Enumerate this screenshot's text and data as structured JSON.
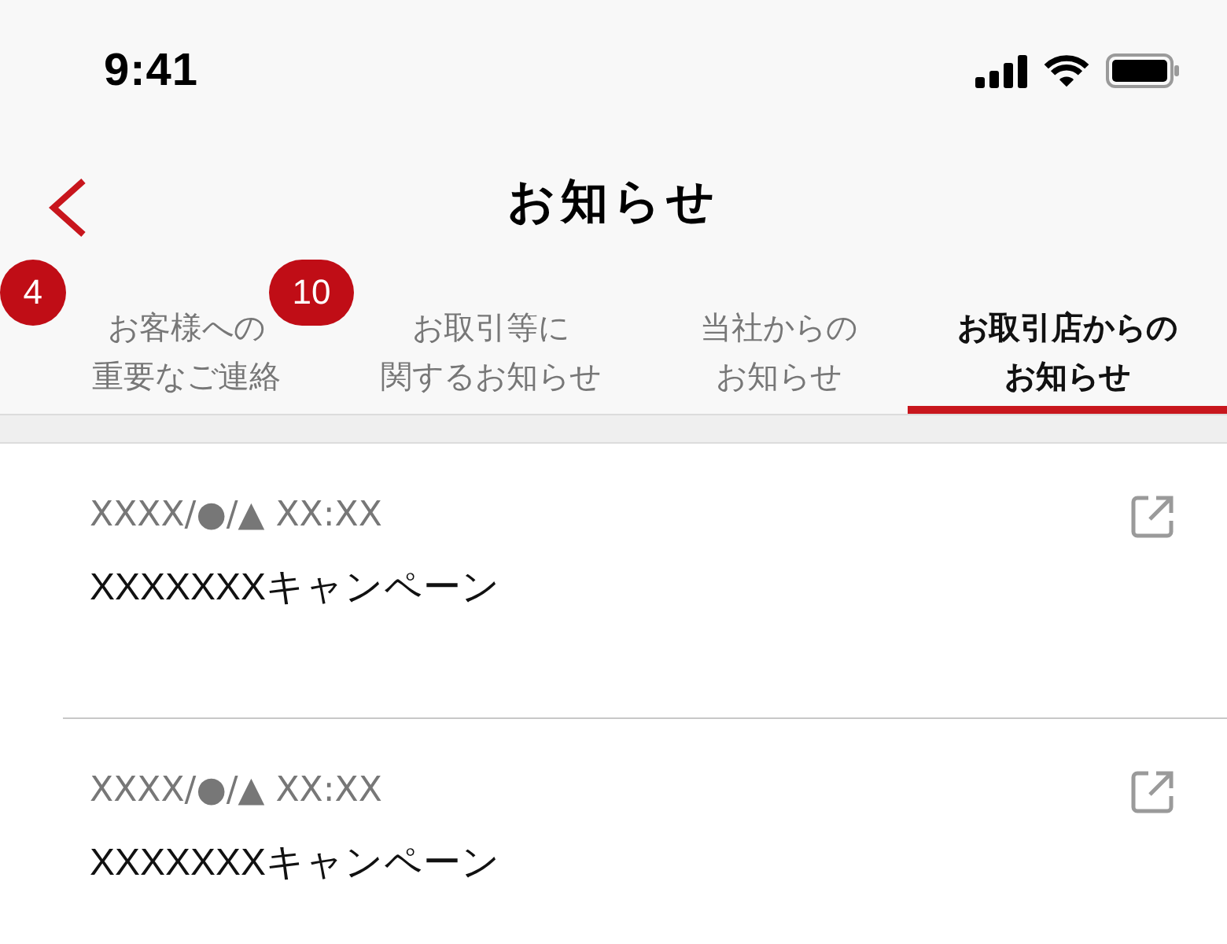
{
  "status_bar": {
    "time": "9:41"
  },
  "nav_bar": {
    "title": "お知らせ"
  },
  "tabs": [
    {
      "label_lines": [
        "お客様への",
        "重要なご連絡"
      ],
      "badge": "4",
      "selected": false
    },
    {
      "label_lines": [
        "お取引等に",
        "関するお知らせ"
      ],
      "badge": "10",
      "selected": false
    },
    {
      "label_lines": [
        "当社からの",
        "お知らせ"
      ],
      "selected": false
    },
    {
      "label_lines": [
        "お取引店からの",
        "お知らせ"
      ],
      "selected": true
    }
  ],
  "notices": [
    {
      "date": "XXXX/●/▲ XX:XX",
      "title": "XXXXXXXキャンペーン"
    },
    {
      "date": "XXXX/●/▲ XX:XX",
      "title": "XXXXXXXキャンペーン"
    }
  ]
}
